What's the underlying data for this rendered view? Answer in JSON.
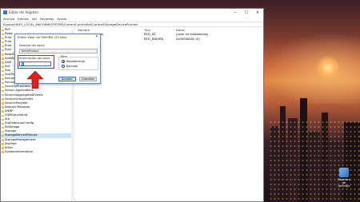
{
  "window": {
    "title": "Editor del Registro",
    "menu": [
      "Archivo",
      "Edición",
      "Ver",
      "Favoritos",
      "Ayuda"
    ],
    "address": "Equipo\\HKEY_LOCAL_MACHINE\\SYSTEM\\CurrentControlSet\\Control\\StorageDevicePolicies"
  },
  "tree": {
    "items": [
      "PnP",
      "Powe",
      "Print",
      "Prior",
      "Prod",
      "Publ",
      "RetailDemo",
      "SafeBoot",
      "SAM",
      "ScE",
      "Scsi",
      "ScsiPort",
      "SecureBoot",
      "SecurePipeServers",
      "SecurityProviders",
      "Server Applications",
      "ServiceAggregatedEvents",
      "ServiceGroupOrder",
      "ServiceProvider",
      "Session Manager",
      "SNMP",
      "SQMServiceList",
      "Srp",
      "SrpExtensionConfig",
      "StillImage",
      "Storage",
      "StorageDevicePolicies",
      "StorageManagement",
      "StorPort",
      "StSec",
      "SystemInformation"
    ],
    "selected_index": 26
  },
  "list": {
    "headers": [
      "Nombre",
      "Tipo",
      "Datos"
    ],
    "rows": [
      {
        "name": "(predeterminado)",
        "type": "REG_SZ",
        "data": "(valor no establecido)"
      },
      {
        "name": "WriteProtect",
        "type": "REG_DWORD",
        "data": "0x00000000 (0)"
      }
    ]
  },
  "dialog": {
    "title": "Editar valor de DWORD (32 bits)",
    "close": "✕",
    "name_label": "Nombre del valor:",
    "name_value": "WriteProtect",
    "data_label": "Información del valor:",
    "data_value": "1",
    "base_label": "Base",
    "radio_hex": "Hexadecimal",
    "radio_dec": "Decimal",
    "ok": "Aceptar",
    "cancel": "Cancelar"
  },
  "desktop": {
    "icon_label": "Papelera de reciclaje"
  },
  "annotation": {
    "arrow_color": "#e02020"
  }
}
